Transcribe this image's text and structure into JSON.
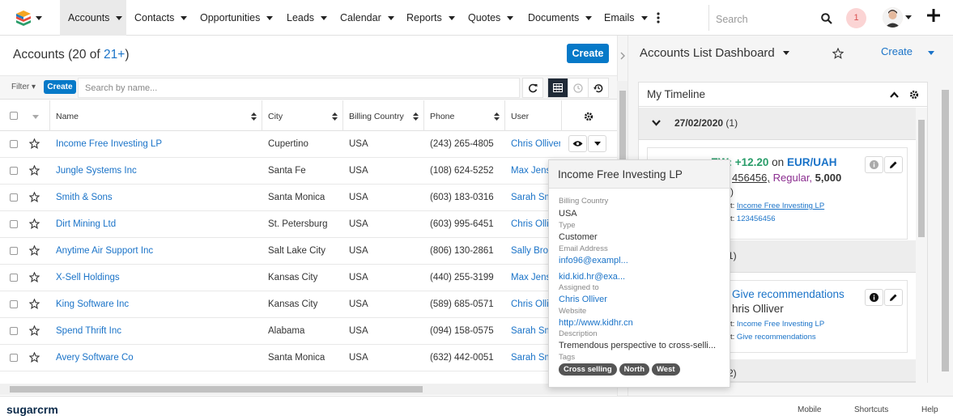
{
  "nav": {
    "tabs": [
      "Accounts",
      "Contacts",
      "Opportunities",
      "Leads",
      "Calendar",
      "Reports",
      "Quotes",
      "Documents",
      "Emails"
    ],
    "search_placeholder": "Search",
    "notifications_count": "1"
  },
  "list": {
    "title": "Accounts",
    "count_prefix": "(20 of ",
    "count_link": "21+",
    "count_suffix": ")",
    "create_label": "Create",
    "filter_label": "Filter",
    "filter_create_label": "Create",
    "search_placeholder": "Search by name...",
    "columns": [
      "Name",
      "City",
      "Billing Country",
      "Phone",
      "User"
    ],
    "rows": [
      {
        "name": "Income Free Investing LP",
        "city": "Cupertino",
        "country": "USA",
        "phone": "(243) 265-4805",
        "user": "Chris Olliver"
      },
      {
        "name": "Jungle Systems Inc",
        "city": "Santa Fe",
        "country": "USA",
        "phone": "(108) 624-5252",
        "user": "Max Jensen"
      },
      {
        "name": "Smith & Sons",
        "city": "Santa Monica",
        "country": "USA",
        "phone": "(603) 183-0316",
        "user": "Sarah Smith"
      },
      {
        "name": "Dirt Mining Ltd",
        "city": "St. Petersburg",
        "country": "USA",
        "phone": "(603) 995-6451",
        "user": "Chris Olliver"
      },
      {
        "name": "Anytime Air Support Inc",
        "city": "Salt Lake City",
        "country": "USA",
        "phone": "(806) 130-2861",
        "user": "Sally Bronsen"
      },
      {
        "name": "X-Sell Holdings",
        "city": "Kansas City",
        "country": "USA",
        "phone": "(440) 255-3199",
        "user": "Max Jensen"
      },
      {
        "name": "King Software Inc",
        "city": "Kansas City",
        "country": "USA",
        "phone": "(589) 685-0571",
        "user": "Chris Olliver"
      },
      {
        "name": "Spend Thrift Inc",
        "city": "Alabama",
        "country": "USA",
        "phone": "(094) 158-0575",
        "user": "Sarah Smith"
      },
      {
        "name": "Avery Software Co",
        "city": "Santa Monica",
        "country": "USA",
        "phone": "(632) 442-0051",
        "user": "Sarah Smith"
      }
    ]
  },
  "dashboard": {
    "title": "Accounts List Dashboard",
    "create_label": "Create",
    "timeline_title": "My Timeline",
    "groups": [
      {
        "date": "27/02/2020",
        "count": "(1)"
      },
      {
        "date": "",
        "count": "(1)"
      },
      {
        "date": "",
        "count": "(2)"
      }
    ],
    "card1": {
      "line1_prefix": "EW: +12.20",
      "line1_mid": " on ",
      "line1_pair": "EUR/UAH",
      "line2_num": "456456,",
      "line2_type": "Regular,",
      "line2_amount": "5,000",
      "line3": ")",
      "related_label": "t:",
      "related_value": "Income Free Investing LP",
      "record_label": "t:",
      "record_value": "123456456"
    },
    "card2": {
      "title": "Give recommendations",
      "assignee": "hris Olliver",
      "related_label": "t:",
      "related_value": "Income Free Investing LP",
      "record_label": "t:",
      "record_value": "Give recommendations"
    }
  },
  "popup": {
    "title": "Income Free Investing LP",
    "billing_country_label": "Billing Country",
    "billing_country": "USA",
    "type_label": "Type",
    "type": "Customer",
    "email_label": "Email Address",
    "email1": "info96@exampl...",
    "email2": "kid.kid.hr@exa...",
    "assigned_label": "Assigned to",
    "assigned": "Chris Olliver",
    "website_label": "Website",
    "website": "http://www.kidhr.cn",
    "description_label": "Description",
    "description": "Tremendous perspective to cross-selli...",
    "tags_label": "Tags",
    "tags": [
      "Cross selling",
      "North",
      "West"
    ]
  },
  "footer": {
    "logo": "sugarcrm",
    "mobile": "Mobile",
    "shortcuts": "Shortcuts",
    "help": "Help"
  },
  "colors": {
    "accent": "#0679c8",
    "link": "#1a73c8",
    "nav_active": "#eaeaea"
  }
}
